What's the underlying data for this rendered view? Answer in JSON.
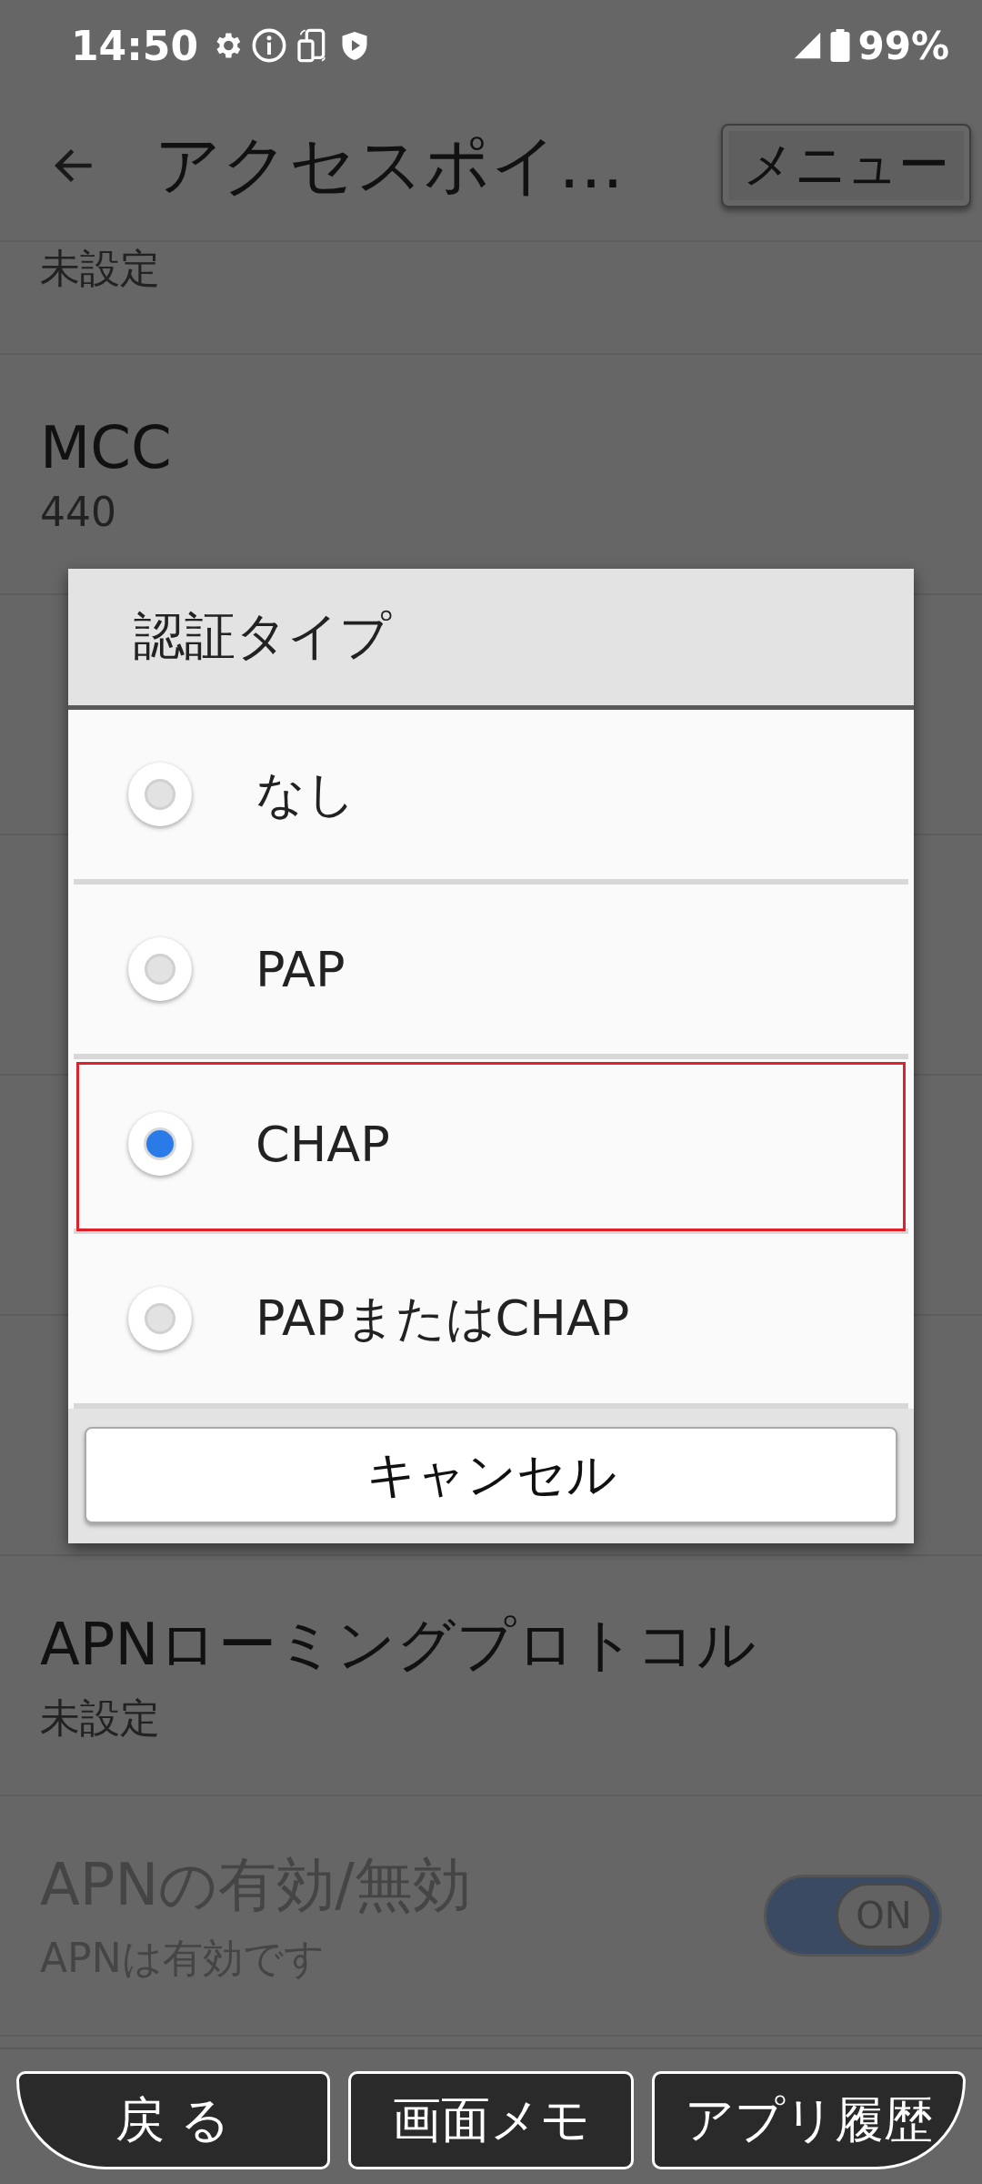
{
  "status_bar": {
    "time": "14:50",
    "battery": "99%"
  },
  "app_bar": {
    "title": "アクセスポイ…",
    "menu_button": "メニュー"
  },
  "settings": [
    {
      "summary": "未設定",
      "disabled": false
    },
    {
      "title": "MCC",
      "summary": "440",
      "disabled": false
    },
    {
      "title": "APNローミングプロトコル",
      "summary": "未設定",
      "disabled": false
    },
    {
      "title": "APNの有効/無効",
      "summary": "APNは有効です",
      "disabled": true,
      "toggle": {
        "on": true,
        "label": "ON"
      }
    }
  ],
  "dialog": {
    "title": "認証タイプ",
    "options": [
      {
        "label": "なし",
        "selected": false,
        "highlighted": false
      },
      {
        "label": "PAP",
        "selected": false,
        "highlighted": false
      },
      {
        "label": "CHAP",
        "selected": true,
        "highlighted": true
      },
      {
        "label": "PAPまたはCHAP",
        "selected": false,
        "highlighted": false
      }
    ],
    "cancel_button": "キャンセル"
  },
  "nav_buttons": [
    "戻 る",
    "画面メモ",
    "アプリ履歴"
  ]
}
